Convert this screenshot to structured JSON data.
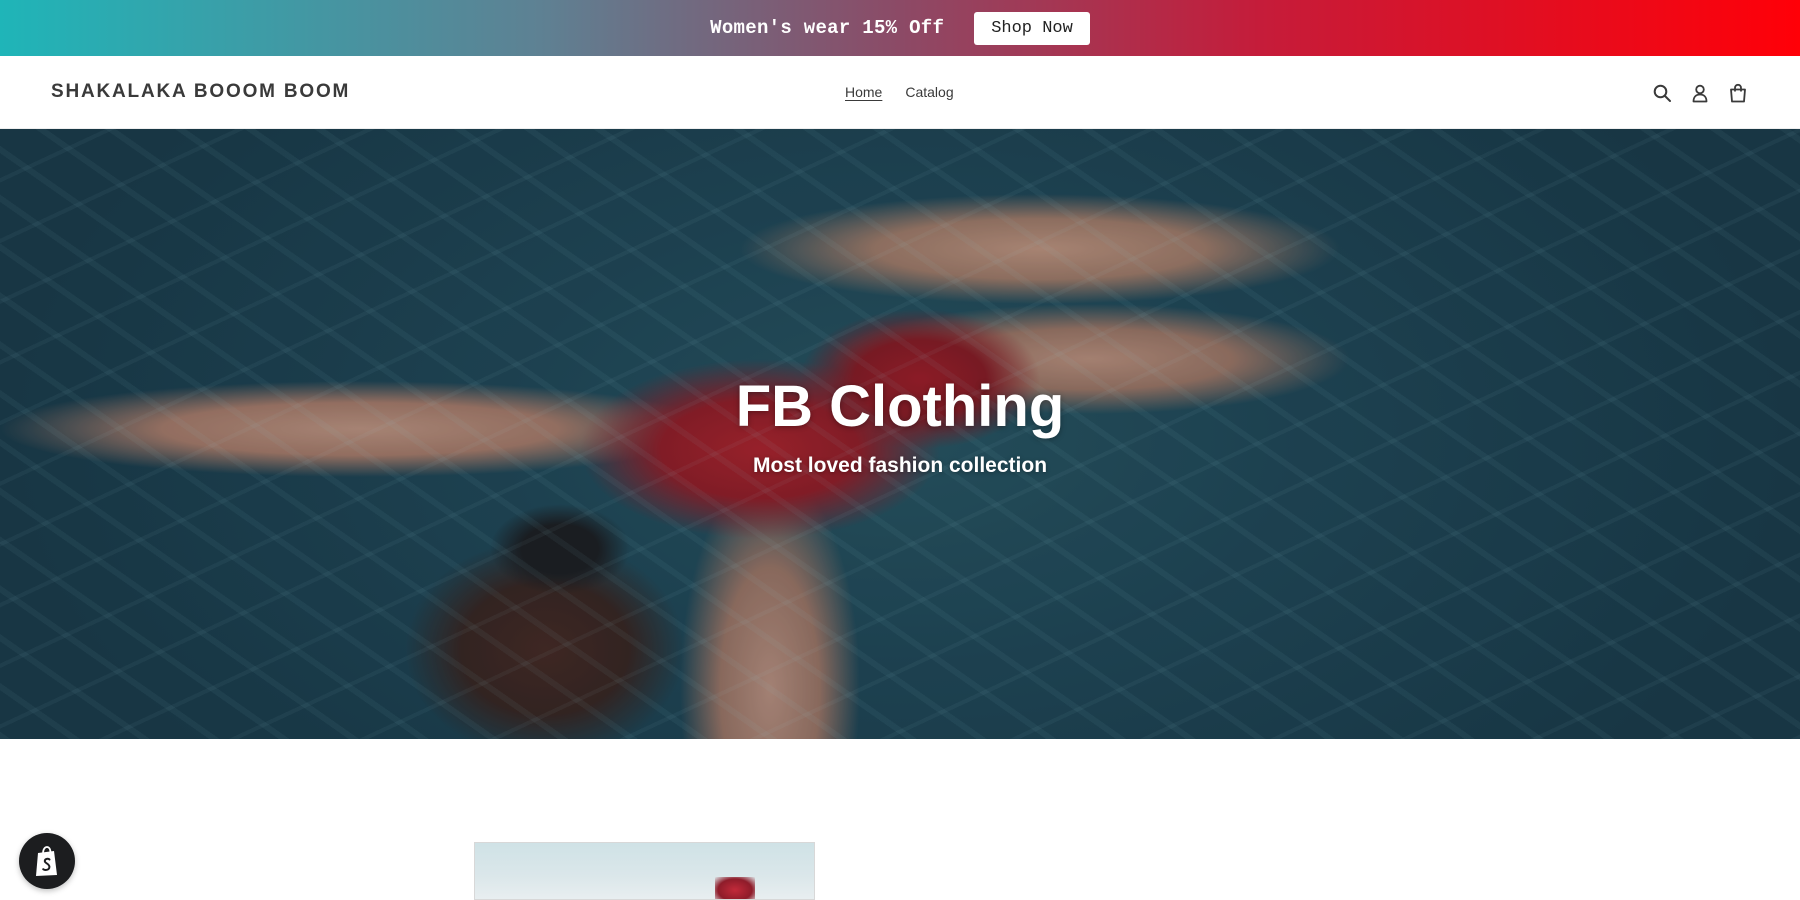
{
  "announcement": {
    "text": "Women's wear 15% Off",
    "button_label": "Shop Now"
  },
  "header": {
    "logo": "SHAKALAKA BOOOM BOOM",
    "nav": [
      {
        "label": "Home",
        "active": true
      },
      {
        "label": "Catalog",
        "active": false
      }
    ],
    "icons": [
      "search-icon",
      "account-icon",
      "cart-icon"
    ]
  },
  "hero": {
    "title": "FB Clothing",
    "subtitle": "Most loved fashion collection"
  },
  "badge": {
    "icon": "shopify-bag-icon"
  },
  "colors": {
    "announcement_gradient_start": "#1fb5b8",
    "announcement_gradient_end": "#ff0008",
    "text_dark": "#3a3a3a",
    "badge_bg": "#1c1d1f"
  }
}
